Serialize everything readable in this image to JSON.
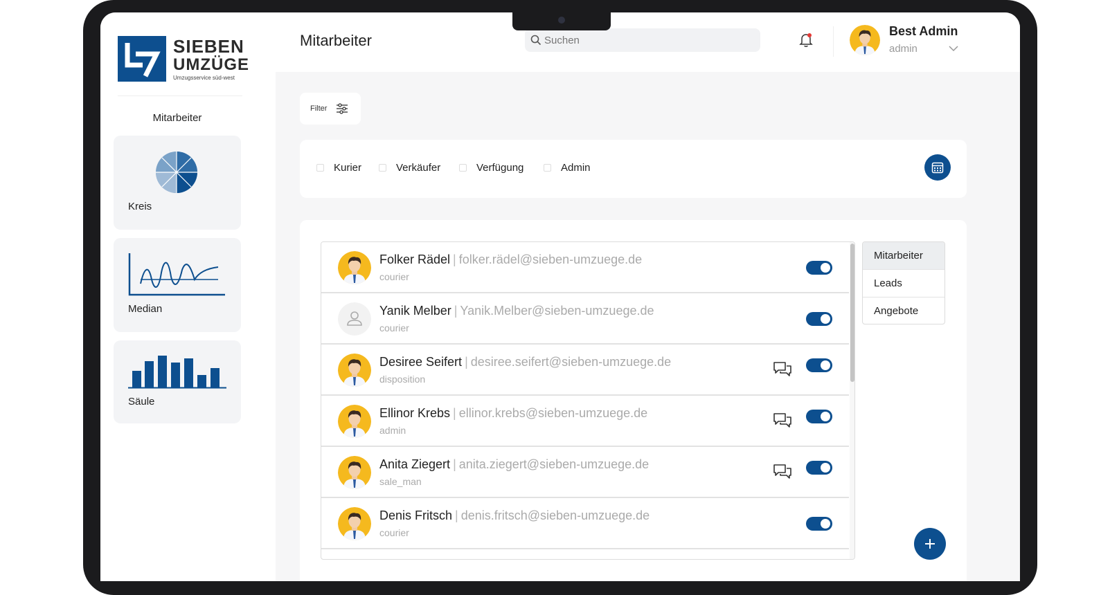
{
  "brand": {
    "line1": "SIEBEN",
    "line2": "UMZÜGE",
    "tagline": "Umzugsservice süd-west"
  },
  "sidebar": {
    "title": "Mitarbeiter",
    "charts": [
      {
        "label": "Kreis"
      },
      {
        "label": "Median"
      },
      {
        "label": "Säule"
      }
    ]
  },
  "header": {
    "title": "Mitarbeiter",
    "search_placeholder": "Suchen",
    "user": {
      "name": "Best Admin",
      "role": "admin"
    }
  },
  "filter": {
    "label": "Filter"
  },
  "roles": [
    "Kurier",
    "Verkäufer",
    "Verfügung",
    "Admin"
  ],
  "employees": [
    {
      "name": "Folker Rädel",
      "email": "folker.rädel@sieben-umzuege.de",
      "role": "courier",
      "avatar": "person",
      "chat": false,
      "active": true
    },
    {
      "name": "Yanik Melber",
      "email": "Yanik.Melber@sieben-umzuege.de",
      "role": "courier",
      "avatar": "placeholder",
      "chat": false,
      "active": true
    },
    {
      "name": "Desiree Seifert",
      "email": "desiree.seifert@sieben-umzuege.de",
      "role": "disposition",
      "avatar": "person",
      "chat": true,
      "active": true
    },
    {
      "name": "Ellinor Krebs",
      "email": "ellinor.krebs@sieben-umzuege.de",
      "role": "admin",
      "avatar": "person",
      "chat": true,
      "active": true
    },
    {
      "name": "Anita Ziegert",
      "email": "anita.ziegert@sieben-umzuege.de",
      "role": "sale_man",
      "avatar": "person",
      "chat": true,
      "active": true
    },
    {
      "name": "Denis Fritsch",
      "email": "denis.fritsch@sieben-umzuege.de",
      "role": "courier",
      "avatar": "person",
      "chat": false,
      "active": true
    }
  ],
  "tabs": [
    "Mitarbeiter",
    "Leads",
    "Angebote"
  ],
  "active_tab": "Mitarbeiter",
  "colors": {
    "accent": "#0d4f8f",
    "background": "#f6f6f7",
    "avatar_bg": "#f5b91e"
  },
  "icons": [
    "search-icon",
    "bell-icon",
    "chevron-down-icon",
    "sliders-icon",
    "calendar-icon",
    "chat-icon",
    "plus-icon",
    "pie-chart-icon",
    "line-chart-icon",
    "bar-chart-icon"
  ]
}
